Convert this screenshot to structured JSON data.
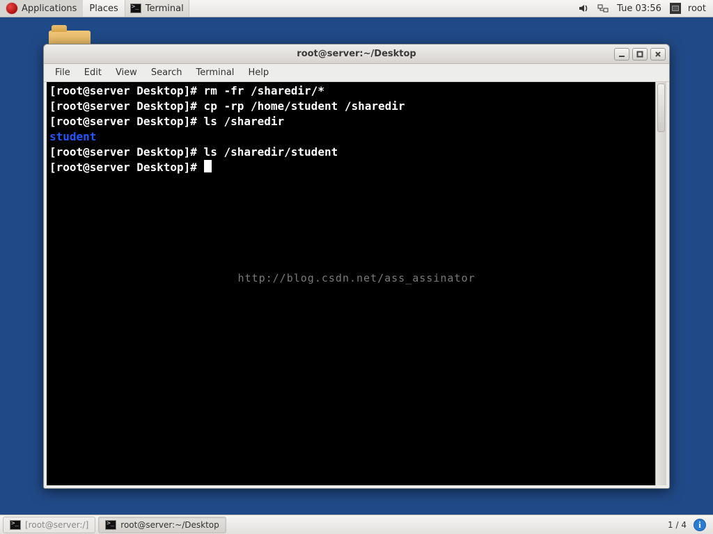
{
  "top_panel": {
    "applications": "Applications",
    "places": "Places",
    "launcher_terminal": "Terminal",
    "clock": "Tue 03:56",
    "user": "root"
  },
  "window": {
    "title": "root@server:~/Desktop",
    "menu": {
      "file": "File",
      "edit": "Edit",
      "view": "View",
      "search": "Search",
      "terminal": "Terminal",
      "help": "Help"
    }
  },
  "terminal": {
    "prompt": "[root@server Desktop]# ",
    "lines": [
      {
        "cmd": "rm -fr /sharedir/*"
      },
      {
        "cmd": "cp -rp /home/student /sharedir"
      },
      {
        "cmd": "ls /sharedir"
      },
      {
        "out": "student",
        "cls": "dir-blue"
      },
      {
        "cmd": "ls /sharedir/student"
      },
      {
        "cmd": "",
        "cursor": true
      }
    ],
    "watermark": "http://blog.csdn.net/ass_assinator"
  },
  "bottom_panel": {
    "task1": "[root@server:/]",
    "task2": "root@server:~/Desktop",
    "pager": "1 / 4"
  }
}
